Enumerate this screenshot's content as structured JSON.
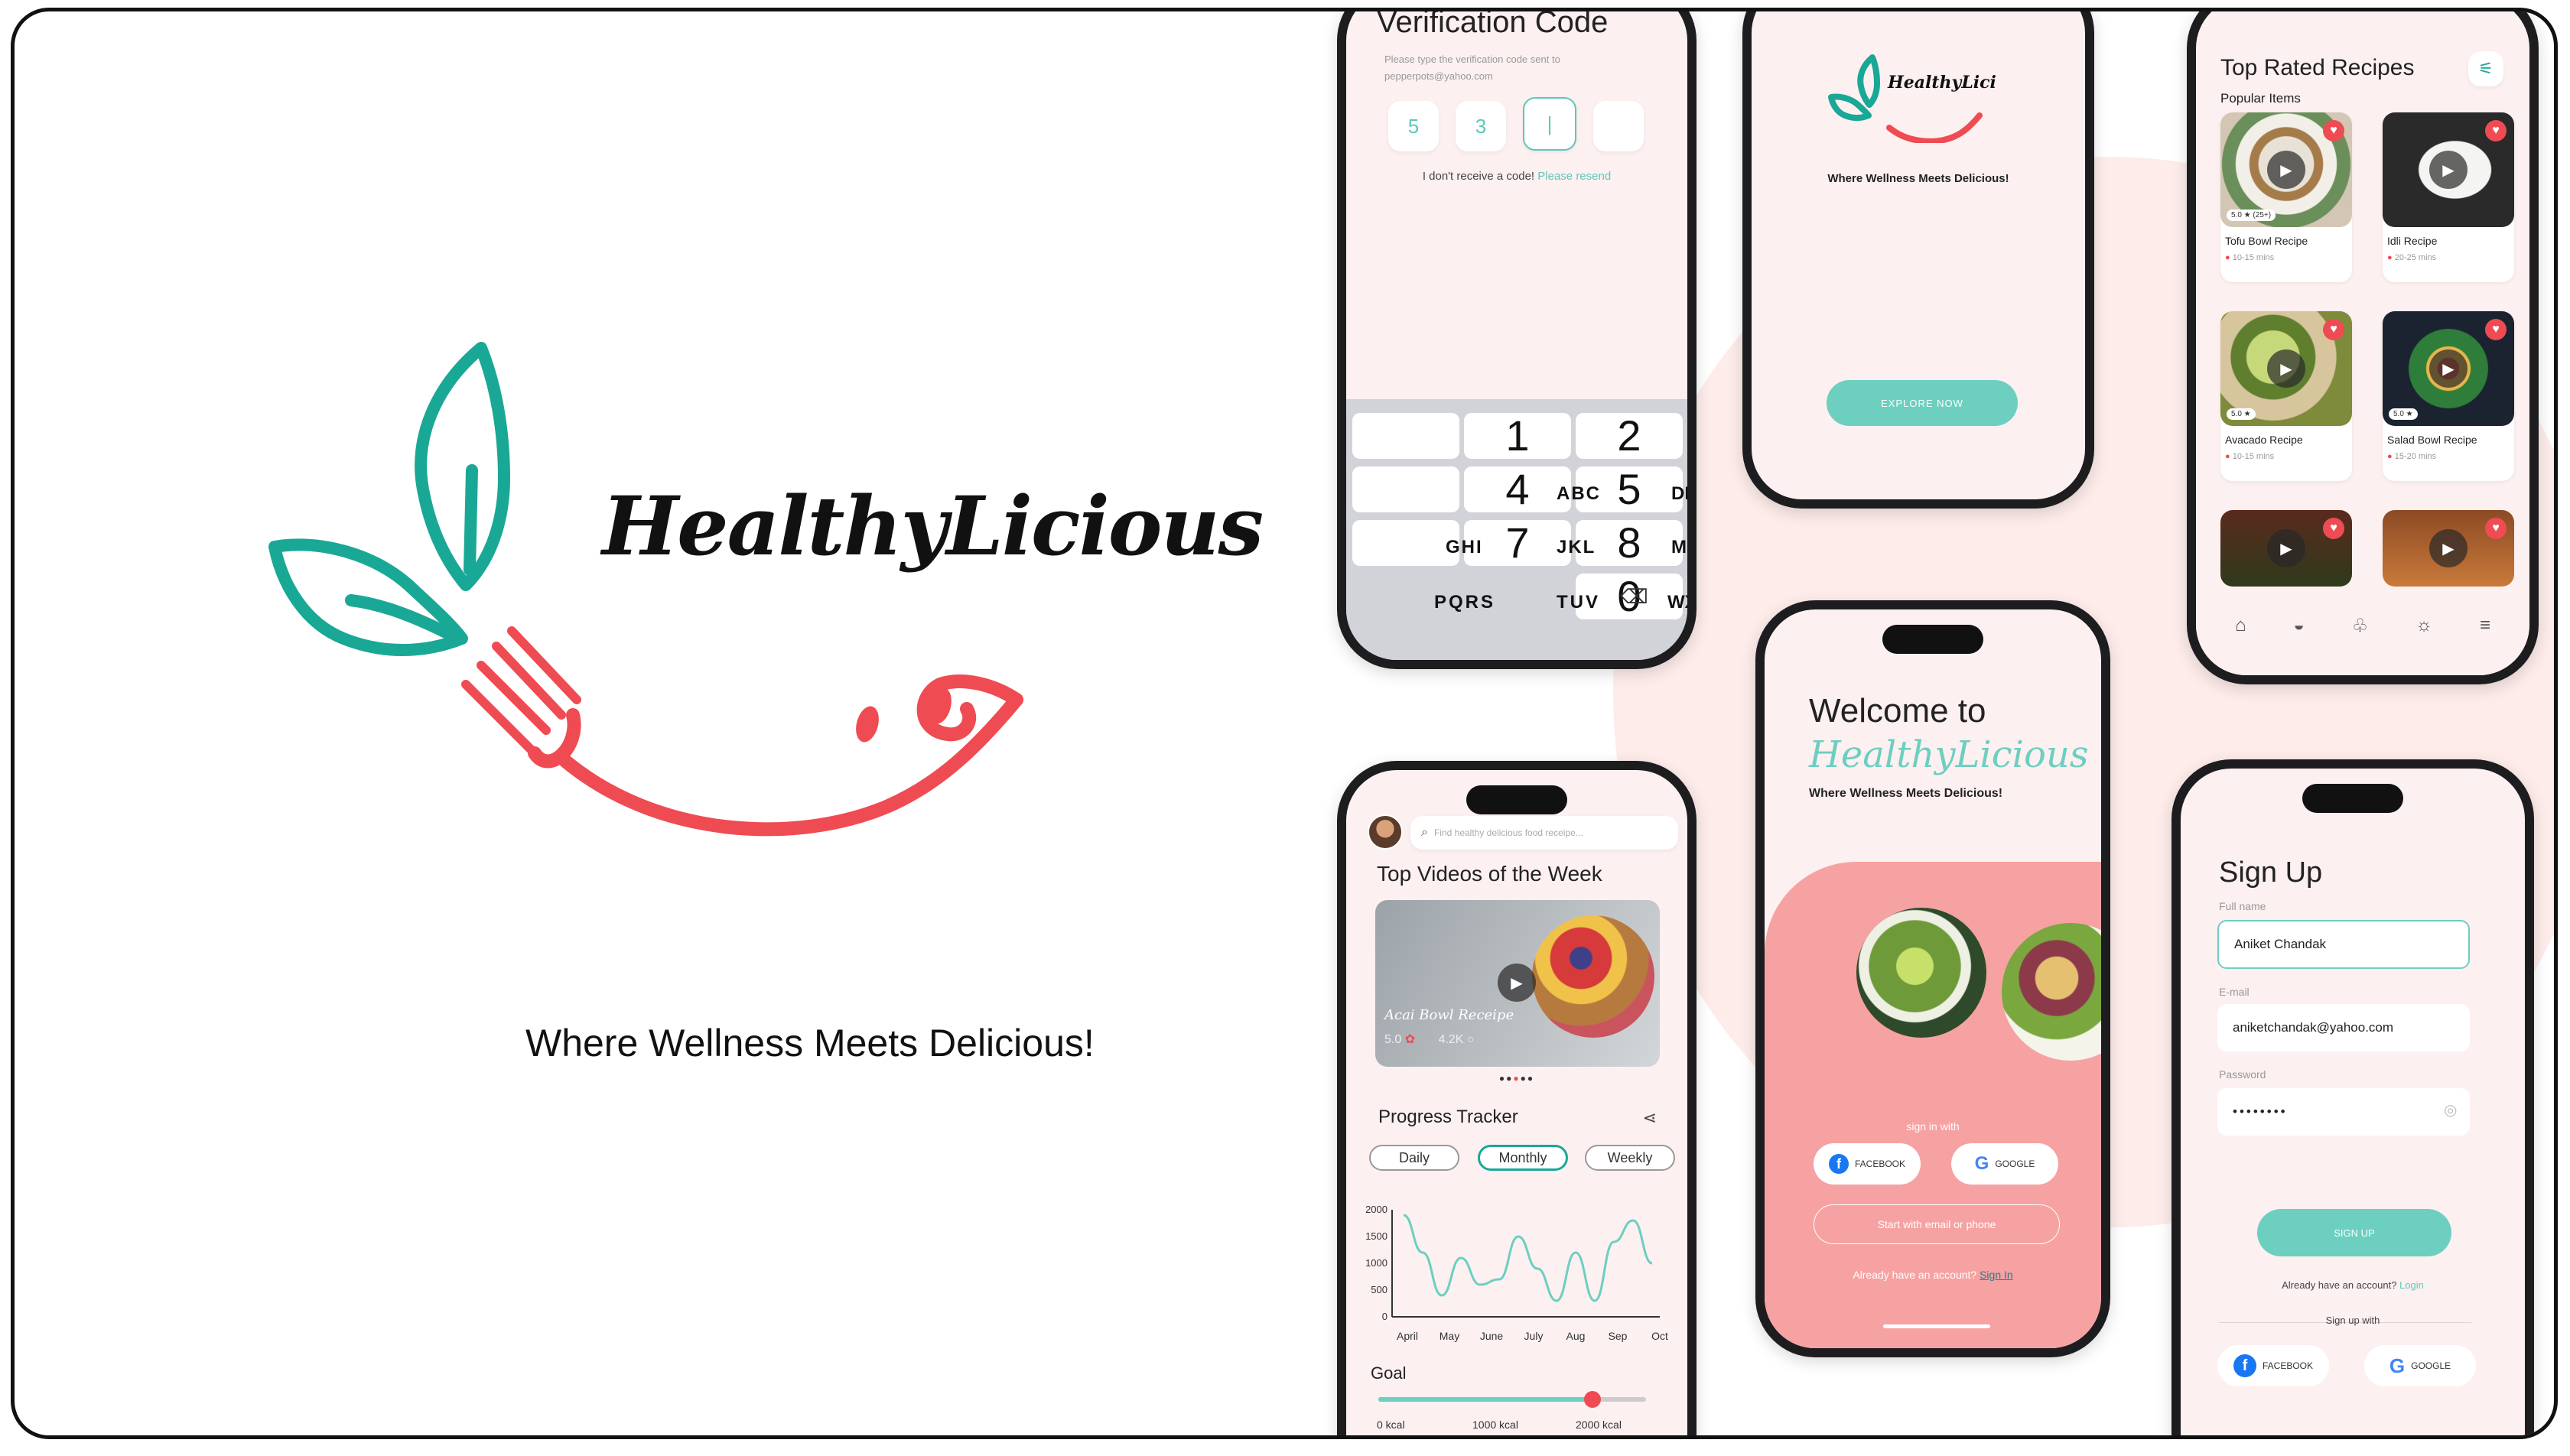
{
  "brand": {
    "name": "HealthyLicious",
    "tagline": "Where Wellness Meets Delicious!"
  },
  "colors": {
    "teal": "#1aa896",
    "red": "#ef4b53",
    "pink": "#f6a2a2",
    "bg_pink": "#fdf0f0"
  },
  "verify": {
    "title": "Verification Code",
    "desc_line1": "Please type the verification code sent to",
    "desc_line2": "pepperpots@yahoo.com",
    "digits": [
      "5",
      "3",
      "|",
      ""
    ],
    "resend_q": "I don't receive a code!",
    "resend_link": "Please resend",
    "keys": [
      {
        "n": "1",
        "l": ""
      },
      {
        "n": "2",
        "l": "ABC"
      },
      {
        "n": "4",
        "l": "GHI"
      },
      {
        "n": "5",
        "l": "JKL"
      },
      {
        "n": "7",
        "l": "PQRS"
      },
      {
        "n": "8",
        "l": "TUV"
      },
      {
        "n": "0",
        "l": ""
      }
    ],
    "side_keys": [
      "DEF",
      "MNO",
      "WXYZ"
    ]
  },
  "splash": {
    "button": "EXPLORE NOW"
  },
  "recipes": {
    "title": "Top Rated Recipes",
    "subtitle": "Popular Items",
    "items": [
      {
        "name": "Tofu Bowl Recipe",
        "rating": "5.0 ★ (25+)",
        "time": "10-15 mins"
      },
      {
        "name": "Idli Recipe",
        "rating": "",
        "time": "20-25 mins"
      },
      {
        "name": "Avacado Recipe",
        "rating": "5.0 ★",
        "time": "10-15 mins"
      },
      {
        "name": "Salad Bowl Recipe",
        "rating": "5.0 ★",
        "time": "15-20 mins"
      }
    ],
    "nav": [
      "home-icon",
      "bowl-icon",
      "chef-icon",
      "bulb-icon",
      "menu-icon"
    ]
  },
  "welcome": {
    "line1": "Welcome to",
    "line2": "HealthyLicious",
    "tagline": "Where Wellness Meets Delicious!",
    "signin_with": "sign in with",
    "facebook": "FACEBOOK",
    "google": "GOOGLE",
    "start": "Start with email or phone",
    "already": "Already have an account?",
    "signin": "Sign In"
  },
  "dashboard": {
    "search_placeholder": "Find healthy delicious food receipe...",
    "videos_title": "Top Videos of the Week",
    "video_name": "Acai Bowl Receipe",
    "video_rating": "5.0",
    "video_views": "4.2K",
    "tracker_title": "Progress Tracker",
    "tabs": [
      "Daily",
      "Monthly",
      "Weekly"
    ],
    "goal_title": "Goal",
    "goal_labels": [
      "0 kcal",
      "1000 kcal",
      "2000 kcal"
    ],
    "goal_value": 0.8
  },
  "chart_data": {
    "type": "line",
    "x": [
      "April",
      "May",
      "June",
      "July",
      "Aug",
      "Sep",
      "Oct"
    ],
    "yticks": [
      "2000",
      "1500",
      "1000",
      "500",
      "0"
    ],
    "ylim": [
      0,
      2000
    ],
    "values": [
      1900,
      1200,
      400,
      1100,
      600,
      700,
      1500,
      900,
      300,
      1200,
      300,
      1400,
      1800,
      1000
    ]
  },
  "signup": {
    "title": "Sign Up",
    "fullname_label": "Full name",
    "fullname": "Aniket Chandak",
    "email_label": "E-mail",
    "email": "aniketchandak@yahoo.com",
    "password_label": "Password",
    "password": "••••••••",
    "button": "SIGN UP",
    "already": "Already have an account?",
    "login": "Login",
    "signup_with": "Sign up with",
    "facebook": "FACEBOOK",
    "google": "GOOGLE"
  }
}
